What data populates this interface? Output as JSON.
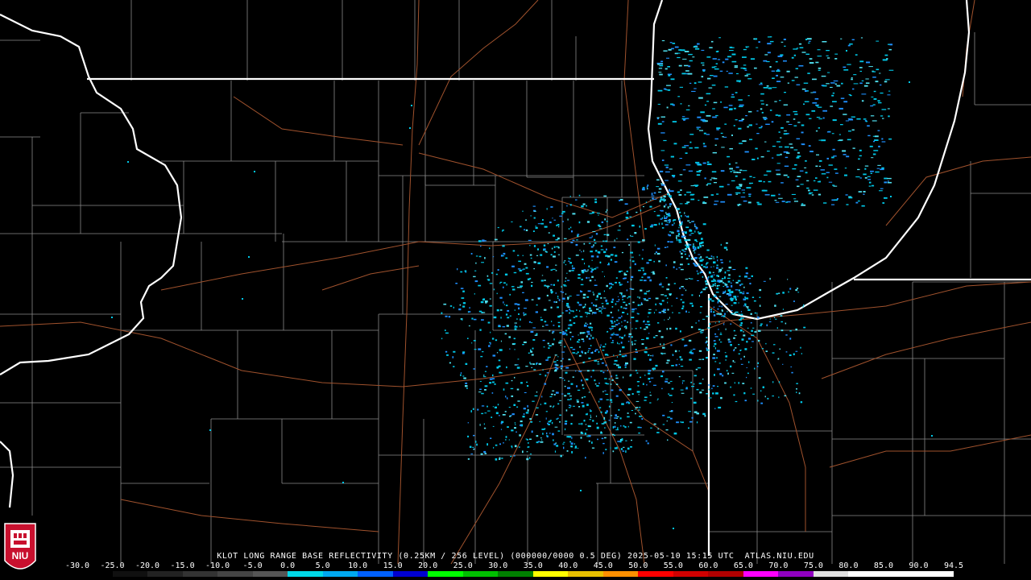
{
  "product_caption": "KLOT LONG RANGE BASE REFLECTIVITY (0.25KM / 256 LEVEL) (000000/0000 0.5 DEG) 2025-05-10 15:15 UTC  ATLAS.NIU.EDU",
  "logo_text": "NIU",
  "scale": {
    "ticks": [
      "-30.0",
      "-25.0",
      "-20.0",
      "-15.0",
      "-10.0",
      "-5.0",
      "0.0",
      "5.0",
      "10.0",
      "15.0",
      "20.0",
      "25.0",
      "30.0",
      "35.0",
      "40.0",
      "45.0",
      "50.0",
      "55.0",
      "60.0",
      "65.0",
      "70.0",
      "75.0",
      "80.0",
      "85.0",
      "90.0",
      "94.5"
    ],
    "colors": [
      "#000000",
      "#101010",
      "#222222",
      "#333333",
      "#444444",
      "#555555",
      "#00d8e8",
      "#00a8f0",
      "#0060ff",
      "#0000d0",
      "#00ff00",
      "#00c000",
      "#008000",
      "#ffff00",
      "#e8c000",
      "#ff9000",
      "#ff0000",
      "#d00000",
      "#b00000",
      "#ff00ff",
      "#9000c0",
      "#e0e0e0",
      "#ffffff",
      "#ffffff",
      "#ffffff"
    ]
  },
  "colors": {
    "background": "#000000",
    "state_border": "#ffffff",
    "county_line": "#8a8a8a",
    "highway": "#a0522d",
    "echo_primary": "#00c8e8",
    "echo_secondary": "#1e90ff"
  }
}
